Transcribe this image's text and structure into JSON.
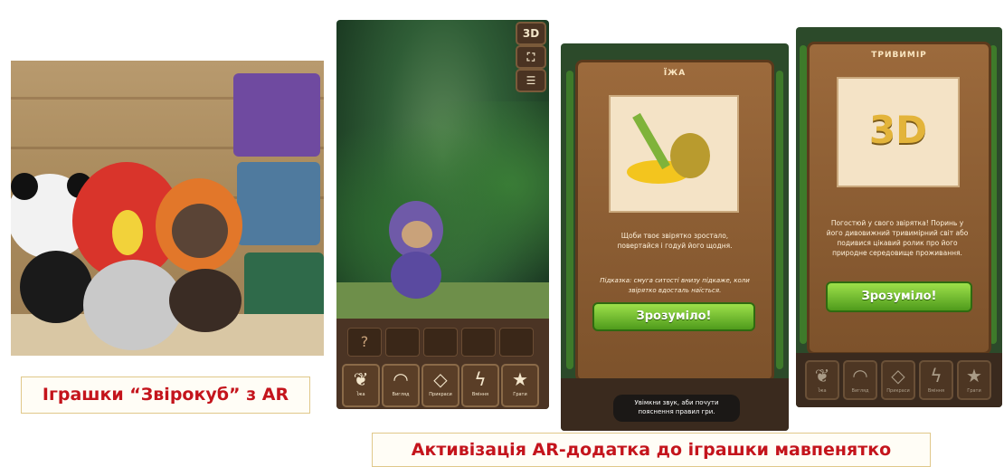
{
  "captions": {
    "toys": "Іграшки “Звірокуб” з AR",
    "activation": "Активізація AR-додатка до іграшки мавпенятко"
  },
  "screen_ar": {
    "buttons": {
      "view3d": "3D"
    },
    "bottom_tabs": [
      {
        "label": "Їжа",
        "icon": "food-icon"
      },
      {
        "label": "Вигляд",
        "icon": "rainbow-icon"
      },
      {
        "label": "Прикраси",
        "icon": "diamond-icon"
      },
      {
        "label": "Вміння",
        "icon": "lightning-icon"
      },
      {
        "label": "Грати",
        "icon": "star-icon"
      }
    ]
  },
  "screen_food": {
    "title": "ЇЖА",
    "text": "Щоби твоє звірятко зростало, повертайся і годуй його щодня.",
    "hint": "Підказка: смуга ситості внизу підкаже, коли звірятко вдосталь наїсться.",
    "button": "Зрозуміло!",
    "tooltip": "Увімкни звук, аби почути пояснення правил гри."
  },
  "screen_3d": {
    "title": "ТРИВИМІР",
    "badge": "3D",
    "text": "Погостюй у свого звірятка! Поринь у його дивовижний тривимірний світ або подивися цікавий ролик про його природне середовище проживання.",
    "button": "Зрозуміло!",
    "bottom_tabs": [
      {
        "label": "Їжа"
      },
      {
        "label": "Вигляд"
      },
      {
        "label": "Прикраси"
      },
      {
        "label": "Вміння"
      },
      {
        "label": "Грати"
      }
    ]
  },
  "colors": {
    "caption_red": "#c4141c",
    "button_green": "#4f9b1c",
    "wood": "#7d522b"
  }
}
